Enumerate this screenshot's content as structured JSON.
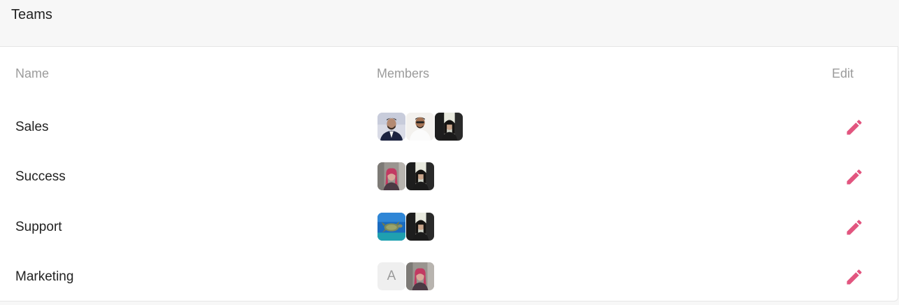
{
  "page": {
    "title": "Teams"
  },
  "table": {
    "headers": {
      "name": "Name",
      "members": "Members",
      "edit": "Edit"
    },
    "accent_color": "#e2557f",
    "rows": [
      {
        "name": "Sales",
        "members": [
          {
            "type": "photo",
            "desc": "man-in-suit"
          },
          {
            "type": "photo",
            "desc": "man-white-shirt"
          },
          {
            "type": "photo",
            "desc": "woman-car"
          }
        ]
      },
      {
        "name": "Success",
        "members": [
          {
            "type": "photo",
            "desc": "woman-pink-hair"
          },
          {
            "type": "photo",
            "desc": "woman-car"
          }
        ]
      },
      {
        "name": "Support",
        "members": [
          {
            "type": "photo",
            "desc": "sea-turtle"
          },
          {
            "type": "photo",
            "desc": "woman-car"
          }
        ]
      },
      {
        "name": "Marketing",
        "members": [
          {
            "type": "initial",
            "letter": "A"
          },
          {
            "type": "photo",
            "desc": "woman-pink-hair"
          }
        ]
      }
    ]
  }
}
